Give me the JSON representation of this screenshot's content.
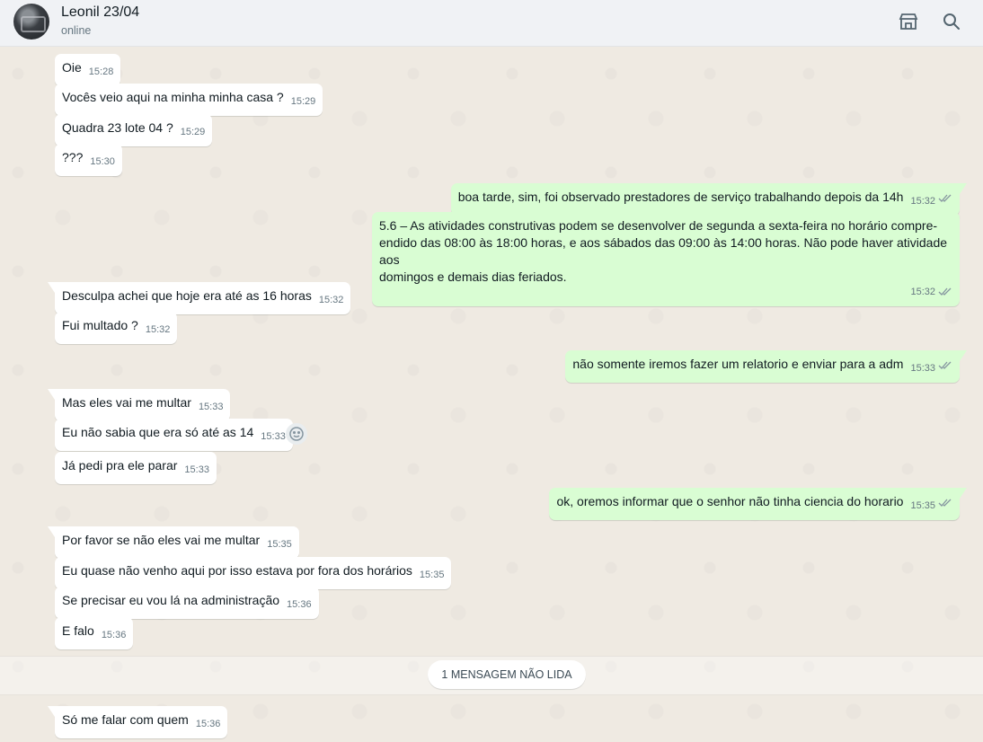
{
  "header": {
    "name": "Leonil 23/04",
    "status": "online",
    "icons": [
      "shop-icon",
      "search-icon"
    ]
  },
  "messages": [
    {
      "text": "Oie",
      "time": "15:28",
      "dir": "in"
    },
    {
      "text": "Vocês veio aqui na minha minha  casa ?",
      "time": "15:29",
      "dir": "in"
    },
    {
      "text": "Quadra 23 lote 04 ?",
      "time": "15:29",
      "dir": "in"
    },
    {
      "text": "???",
      "time": "15:30",
      "dir": "in"
    },
    {
      "text": "boa tarde, sim, foi observado prestadores de serviço trabalhando depois da 14h",
      "time": "15:32",
      "dir": "out"
    },
    {
      "lines": [
        "5.6 – As atividades construtivas podem se desenvolver de segunda a sexta-feira no horário compre-",
        "endido das 08:00 às 18:00 horas, e aos sábados das 09:00 às 14:00 horas. Não pode haver atividade aos",
        "domingos e demais dias feriados."
      ],
      "time": "15:32",
      "dir": "out"
    },
    {
      "text": "Desculpa achei que hoje  era até as 16 horas",
      "time": "15:32",
      "dir": "in"
    },
    {
      "text": "Fui multado ?",
      "time": "15:32",
      "dir": "in"
    },
    {
      "text": "não somente iremos fazer um relatorio e enviar para a adm",
      "time": "15:33",
      "dir": "out"
    },
    {
      "text": "Mas eles vai me multar",
      "time": "15:33",
      "dir": "in"
    },
    {
      "text": "Eu não sabia  que era só até as 14",
      "time": "15:33",
      "dir": "in"
    },
    {
      "text": "Já pedi pra ele parar",
      "time": "15:33",
      "dir": "in"
    },
    {
      "text": "ok, oremos informar que o senhor não tinha ciencia do horario",
      "time": "15:35",
      "dir": "out"
    },
    {
      "text": "Por favor se não eles vai me multar",
      "time": "15:35",
      "dir": "in"
    },
    {
      "text": "Eu quase não venho aqui por isso estava por fora dos horários",
      "time": "15:35",
      "dir": "in"
    },
    {
      "text": "Se precisar eu vou lá na  administração",
      "time": "15:36",
      "dir": "in"
    },
    {
      "text": "E falo",
      "time": "15:36",
      "dir": "in"
    },
    {
      "text": "Só me falar com quem",
      "time": "15:36",
      "dir": "in"
    }
  ],
  "unread_label": "1 MENSAGEM NÃO LIDA",
  "colors": {
    "incoming": "#ffffff",
    "outgoing": "#d9fdd3",
    "read_ticks": "#8696a0",
    "background": "#efeae2"
  }
}
